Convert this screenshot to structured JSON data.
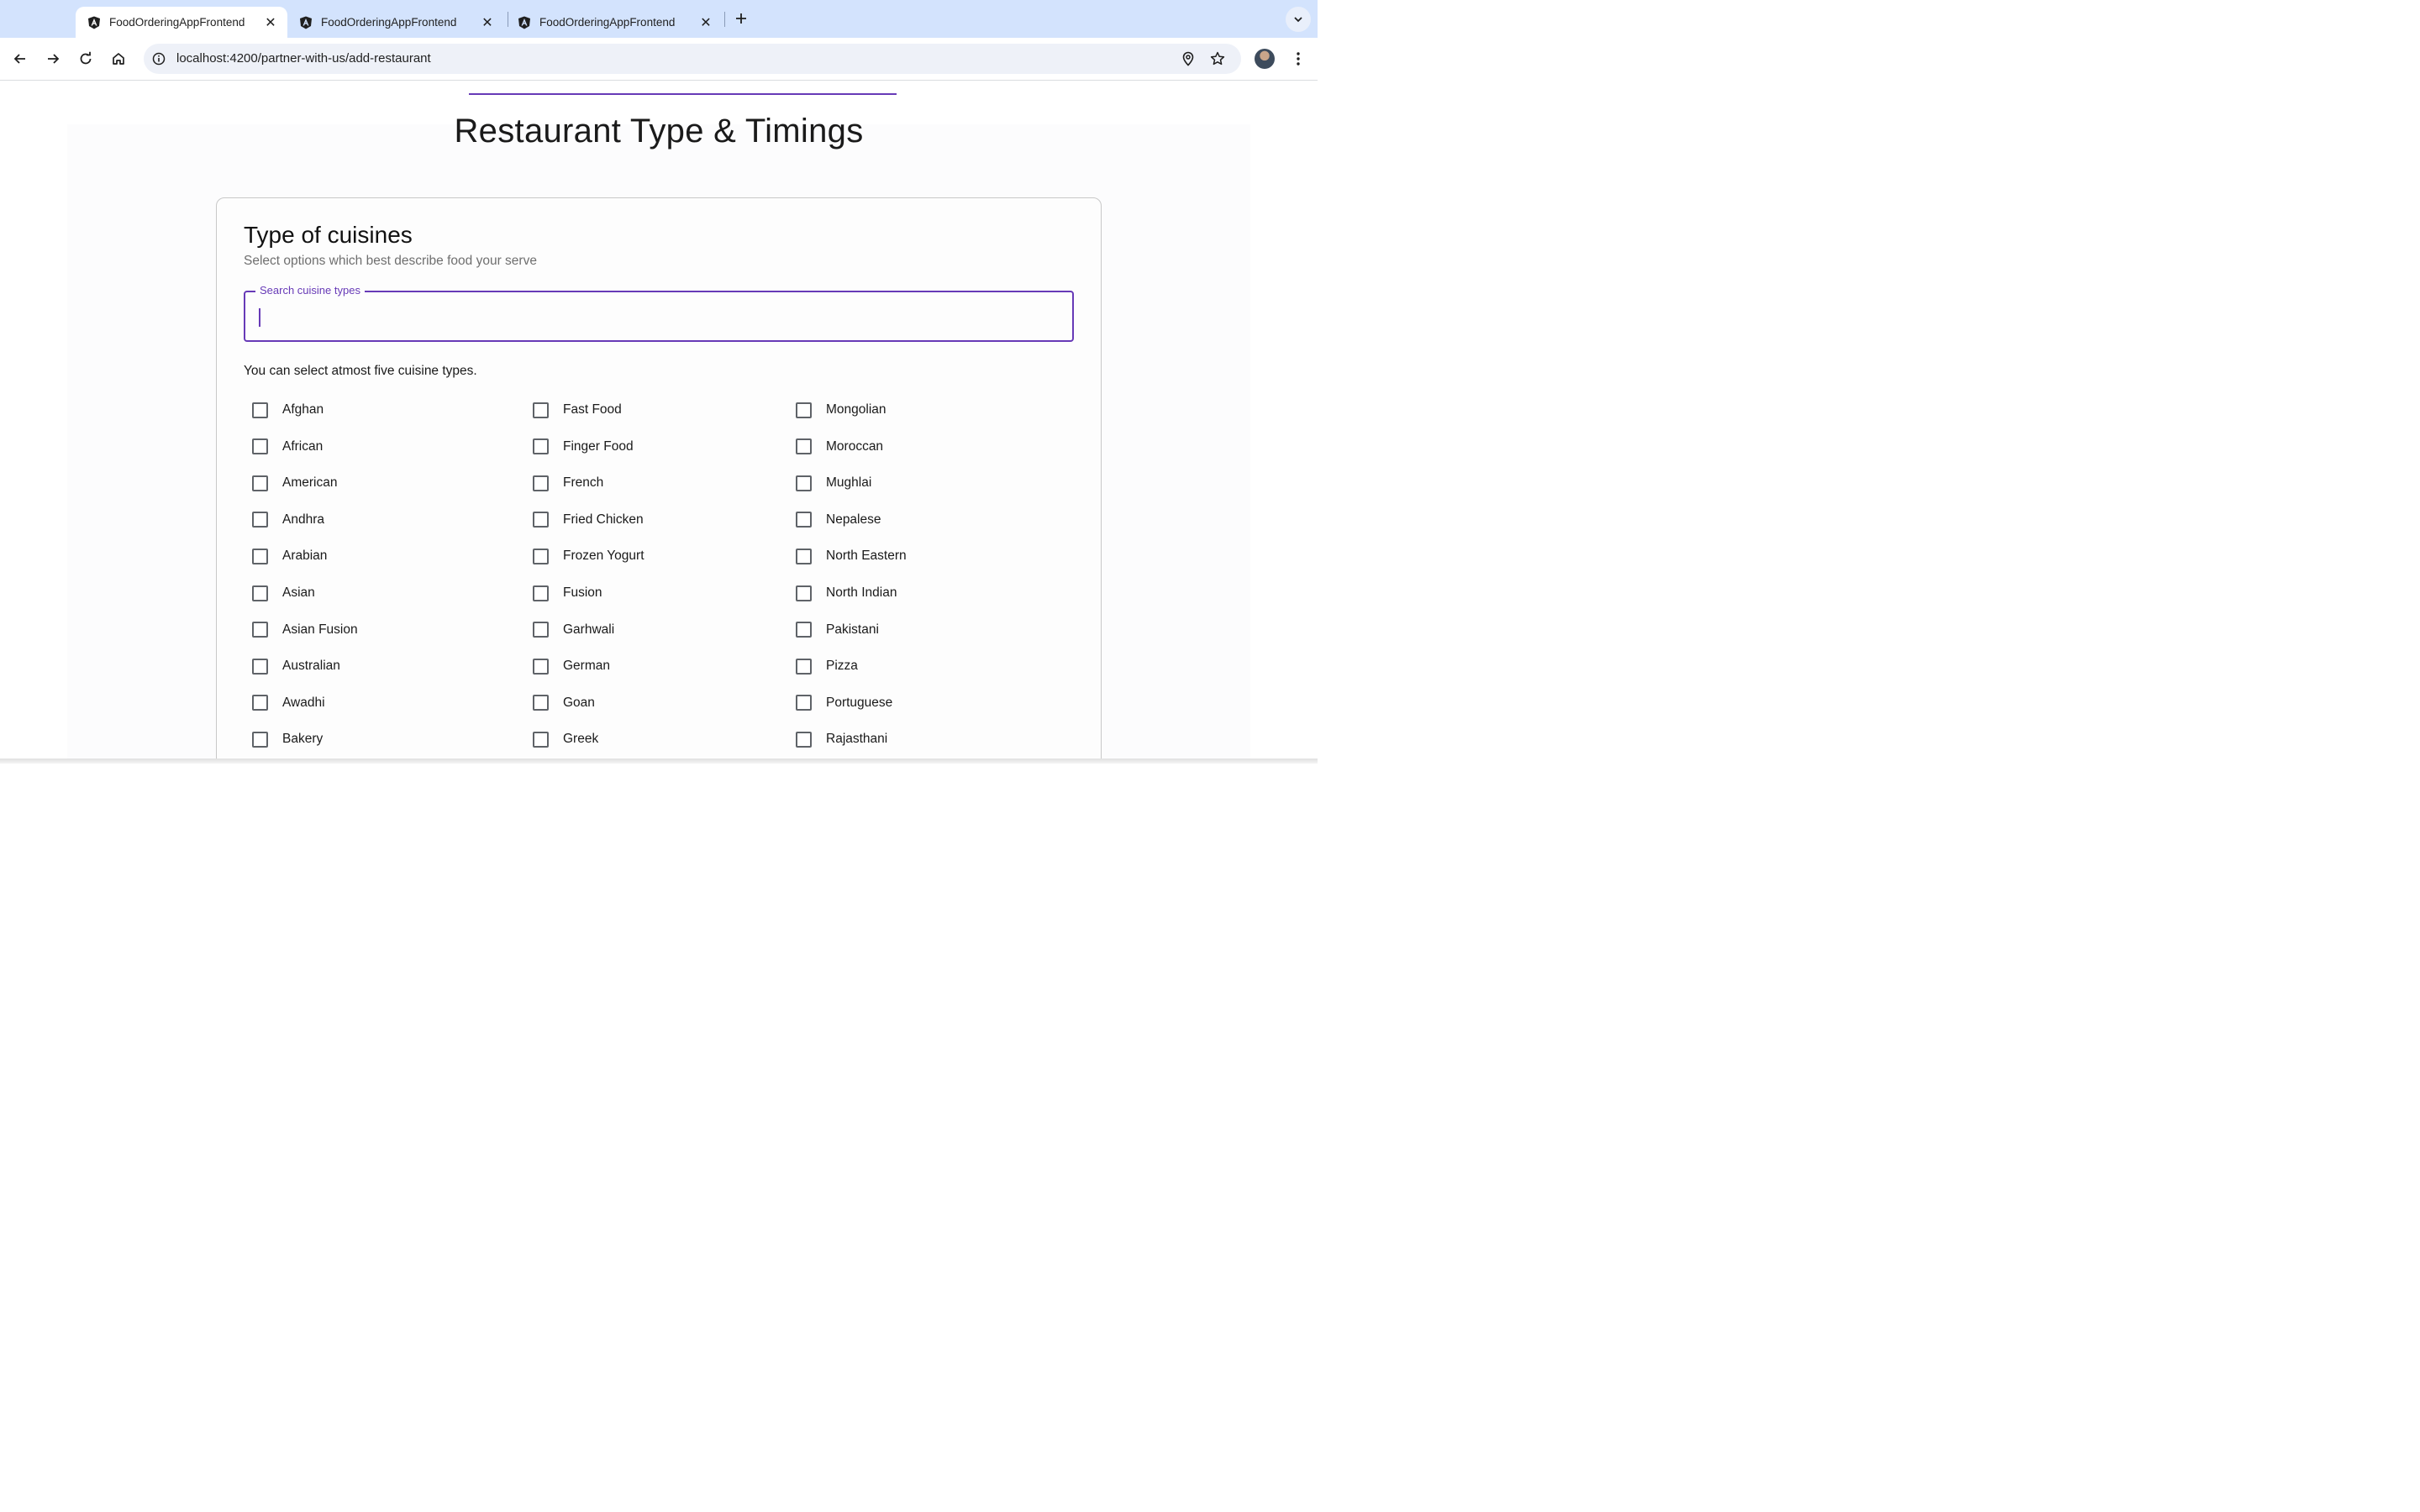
{
  "browser": {
    "tabs": [
      {
        "title": "FoodOrderingAppFrontend",
        "active": true
      },
      {
        "title": "FoodOrderingAppFrontend",
        "active": false
      },
      {
        "title": "FoodOrderingAppFrontend",
        "active": false
      }
    ],
    "url": "localhost:4200/partner-with-us/add-restaurant",
    "accent": "#d3e3fd"
  },
  "page": {
    "title": "Restaurant Type & Timings",
    "accent": "#673ab7"
  },
  "cuisines": {
    "heading": "Type of cuisines",
    "subheading": "Select options which best describe food your serve",
    "search": {
      "label": "Search cuisine types",
      "value": ""
    },
    "hint": "You can select atmost five cuisine types.",
    "columns": [
      [
        "Afghan",
        "African",
        "American",
        "Andhra",
        "Arabian",
        "Asian",
        "Asian Fusion",
        "Australian",
        "Awadhi",
        "Bakery"
      ],
      [
        "Fast Food",
        "Finger Food",
        "French",
        "Fried Chicken",
        "Frozen Yogurt",
        "Fusion",
        "Garhwali",
        "German",
        "Goan",
        "Greek"
      ],
      [
        "Mongolian",
        "Moroccan",
        "Mughlai",
        "Nepalese",
        "North Eastern",
        "North Indian",
        "Pakistani",
        "Pizza",
        "Portuguese",
        "Rajasthani"
      ]
    ]
  }
}
